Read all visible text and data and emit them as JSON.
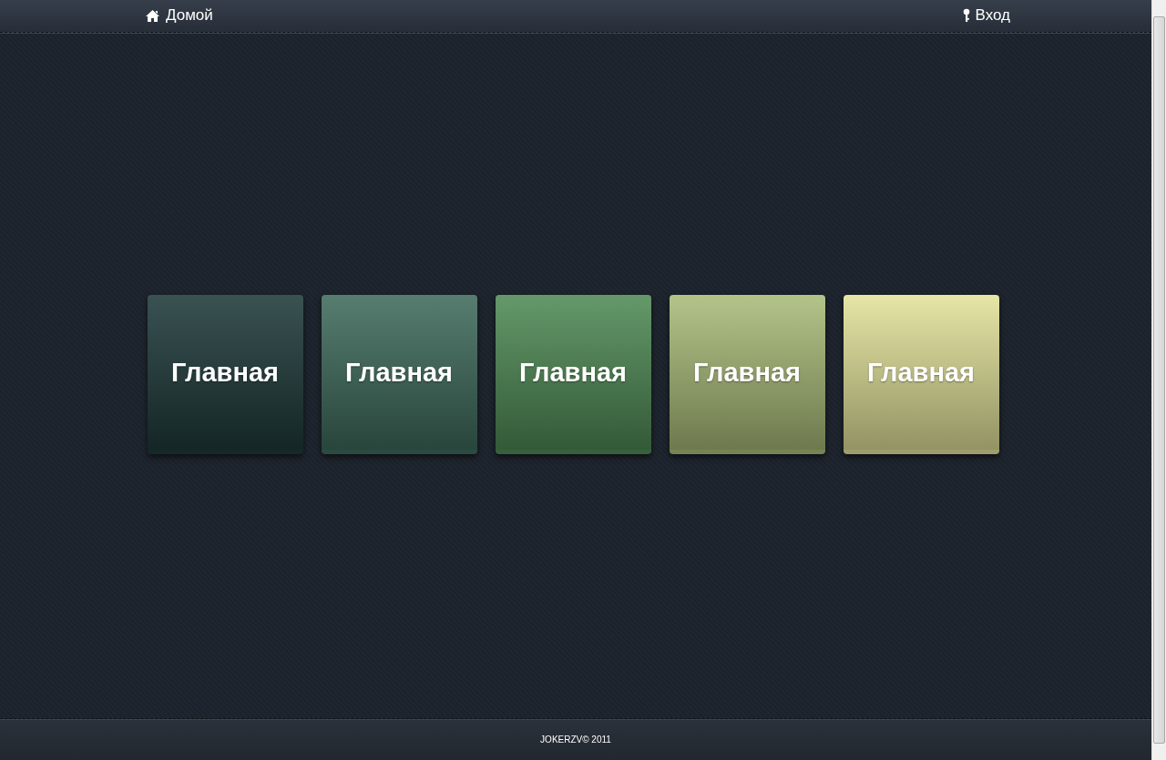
{
  "header": {
    "home_link": "Домой",
    "login_link": "Вход"
  },
  "tiles": [
    {
      "label": "Главная",
      "color": "#1f3a3a"
    },
    {
      "label": "Главная",
      "color": "#3f6b5c"
    },
    {
      "label": "Главная",
      "color": "#4f8a55"
    },
    {
      "label": "Главная",
      "color": "#a9bb78"
    },
    {
      "label": "Главная",
      "color": "#e2e29a"
    }
  ],
  "footer": {
    "copyright": "JOKERZV© 2011"
  }
}
